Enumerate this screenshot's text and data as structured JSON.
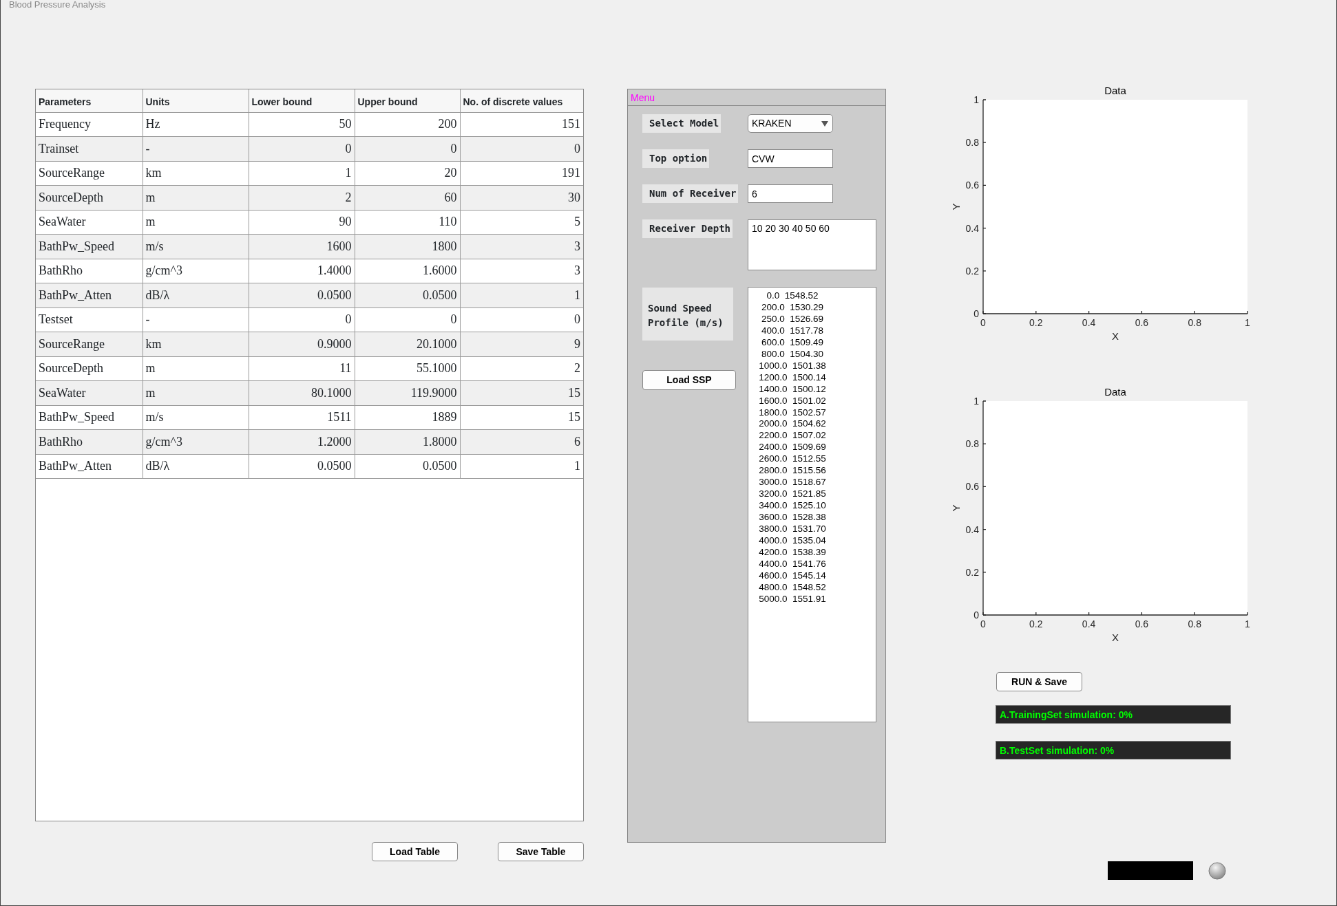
{
  "window": {
    "title": "Blood Pressure Analysis"
  },
  "table": {
    "columns": [
      "Parameters",
      "Units",
      "Lower bound",
      "Upper bound",
      "No. of discrete values"
    ],
    "rows": [
      {
        "parameter": "Frequency",
        "unit": "Hz",
        "lower": "50",
        "upper": "200",
        "count": "151"
      },
      {
        "parameter": "Trainset",
        "unit": "-",
        "lower": "0",
        "upper": "0",
        "count": "0"
      },
      {
        "parameter": "SourceRange",
        "unit": "km",
        "lower": "1",
        "upper": "20",
        "count": "191"
      },
      {
        "parameter": "SourceDepth",
        "unit": "m",
        "lower": "2",
        "upper": "60",
        "count": "30"
      },
      {
        "parameter": "SeaWater",
        "unit": "m",
        "lower": "90",
        "upper": "110",
        "count": "5"
      },
      {
        "parameter": "BathPw_Speed",
        "unit": "m/s",
        "lower": "1600",
        "upper": "1800",
        "count": "3"
      },
      {
        "parameter": "BathRho",
        "unit": "g/cm^3",
        "lower": "1.4000",
        "upper": "1.6000",
        "count": "3"
      },
      {
        "parameter": "BathPw_Atten",
        "unit": "dB/λ",
        "lower": "0.0500",
        "upper": "0.0500",
        "count": "1"
      },
      {
        "parameter": "Testset",
        "unit": "-",
        "lower": "0",
        "upper": "0",
        "count": "0"
      },
      {
        "parameter": "SourceRange",
        "unit": "km",
        "lower": "0.9000",
        "upper": "20.1000",
        "count": "9"
      },
      {
        "parameter": "SourceDepth",
        "unit": "m",
        "lower": "11",
        "upper": "55.1000",
        "count": "2"
      },
      {
        "parameter": "SeaWater",
        "unit": "m",
        "lower": "80.1000",
        "upper": "119.9000",
        "count": "15"
      },
      {
        "parameter": "BathPw_Speed",
        "unit": "m/s",
        "lower": "1511",
        "upper": "1889",
        "count": "15"
      },
      {
        "parameter": "BathRho",
        "unit": "g/cm^3",
        "lower": "1.2000",
        "upper": "1.8000",
        "count": "6"
      },
      {
        "parameter": "BathPw_Atten",
        "unit": "dB/λ",
        "lower": "0.0500",
        "upper": "0.0500",
        "count": "1"
      }
    ]
  },
  "table_buttons": [
    "Load Table",
    "Save Table"
  ],
  "menu": {
    "title": "Menu",
    "fields": [
      {
        "kind": "dropdown",
        "label": "Select Model",
        "value": "KRAKEN"
      },
      {
        "kind": "text",
        "label": "Top option",
        "value": "CVW"
      },
      {
        "kind": "text",
        "label": "Num of Receiver",
        "value": "6"
      },
      {
        "kind": "textarea",
        "label": "Receiver Depth",
        "value": "10 20 30 40 50 60"
      }
    ],
    "ssp": {
      "label": "Sound Speed Profile (m/s)",
      "button": "Load SSP",
      "lines": [
        "0.0  1548.52",
        "200.0  1530.29",
        "250.0  1526.69",
        "400.0  1517.78",
        "600.0  1509.49",
        "800.0  1504.30",
        "1000.0  1501.38",
        "1200.0  1500.14",
        "1400.0  1500.12",
        "1600.0  1501.02",
        "1800.0  1502.57",
        "2000.0  1504.62",
        "2200.0  1507.02",
        "2400.0  1509.69",
        "2600.0  1512.55",
        "2800.0  1515.56",
        "3000.0  1518.67",
        "3200.0  1521.85",
        "3400.0  1525.10",
        "3600.0  1528.38",
        "3800.0  1531.70",
        "4000.0  1535.04",
        "4200.0  1538.39",
        "4400.0  1541.76",
        "4600.0  1545.14",
        "4800.0  1548.52",
        "5000.0  1551.91"
      ]
    }
  },
  "plots": [
    {
      "chart_data": {
        "type": "line",
        "title": "Data",
        "xlabel": "X",
        "ylabel": "Y",
        "xlim": [
          0,
          1
        ],
        "ylim": [
          0,
          1
        ],
        "xticks": [
          0,
          0.2,
          0.4,
          0.6,
          0.8,
          1
        ],
        "yticks": [
          0,
          0.2,
          0.4,
          0.6,
          0.8,
          1
        ]
      }
    },
    {
      "chart_data": {
        "type": "line",
        "title": "Data",
        "xlabel": "X",
        "ylabel": "Y",
        "xlim": [
          0,
          1
        ],
        "ylim": [
          0,
          1
        ],
        "xticks": [
          0,
          0.2,
          0.4,
          0.6,
          0.8,
          1
        ],
        "yticks": [
          0,
          0.2,
          0.4,
          0.6,
          0.8,
          1
        ]
      }
    }
  ],
  "run_button": "RUN & Save",
  "progress": [
    "A.TrainingSet simulation: 0%",
    "B.TestSet simulation: 0%"
  ]
}
